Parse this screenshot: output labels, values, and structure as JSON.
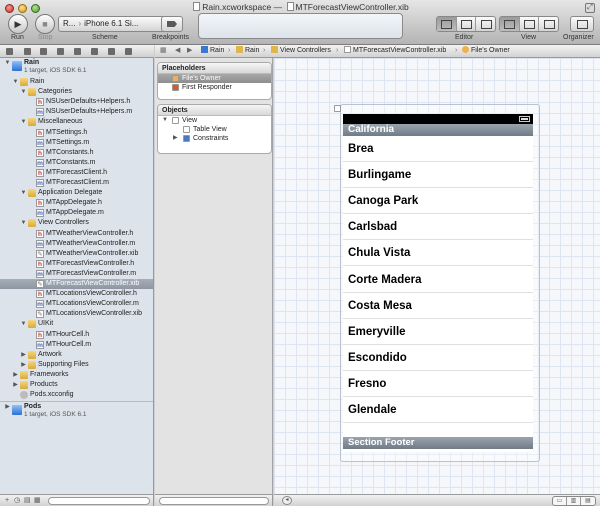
{
  "window": {
    "workspace": "Rain.xcworkspace",
    "separator": "—",
    "document": "MTForecastViewController.xib"
  },
  "toolbar": {
    "run_label": "Run",
    "stop_label": "Stop",
    "scheme_label": "Scheme",
    "breakpoints_label": "Breakpoints",
    "editor_label": "Editor",
    "view_label": "View",
    "organizer_label": "Organizer",
    "scheme_target": "R...",
    "scheme_separator": "›",
    "scheme_device": "iPhone 6.1 Si..."
  },
  "navigator": {
    "items": [
      {
        "label": "Rain",
        "sub": "1 target, iOS SDK 6.1",
        "icon": "project-icon",
        "indent": 0,
        "disclosure": "▼",
        "type": "project"
      },
      {
        "label": "Rain",
        "icon": "folder-icon",
        "indent": 1,
        "disclosure": "▼"
      },
      {
        "label": "Categories",
        "icon": "folder-icon",
        "indent": 2,
        "disclosure": "▼"
      },
      {
        "label": "NSUserDefaults+Helpers.h",
        "icon": "header-file-icon",
        "indent": 3
      },
      {
        "label": "NSUserDefaults+Helpers.m",
        "icon": "implementation-file-icon",
        "indent": 3
      },
      {
        "label": "Miscellaneous",
        "icon": "folder-icon",
        "indent": 2,
        "disclosure": "▼"
      },
      {
        "label": "MTSettings.h",
        "icon": "header-file-icon",
        "indent": 3
      },
      {
        "label": "MTSettings.m",
        "icon": "implementation-file-icon",
        "indent": 3
      },
      {
        "label": "MTConstants.h",
        "icon": "header-file-icon",
        "indent": 3
      },
      {
        "label": "MTConstants.m",
        "icon": "implementation-file-icon",
        "indent": 3
      },
      {
        "label": "MTForecastClient.h",
        "icon": "header-file-icon",
        "indent": 3
      },
      {
        "label": "MTForecastClient.m",
        "icon": "implementation-file-icon",
        "indent": 3
      },
      {
        "label": "Application Delegate",
        "icon": "folder-icon",
        "indent": 2,
        "disclosure": "▼"
      },
      {
        "label": "MTAppDelegate.h",
        "icon": "header-file-icon",
        "indent": 3
      },
      {
        "label": "MTAppDelegate.m",
        "icon": "implementation-file-icon",
        "indent": 3
      },
      {
        "label": "View Controllers",
        "icon": "folder-icon",
        "indent": 2,
        "disclosure": "▼"
      },
      {
        "label": "MTWeatherViewController.h",
        "icon": "header-file-icon",
        "indent": 3
      },
      {
        "label": "MTWeatherViewController.m",
        "icon": "implementation-file-icon",
        "indent": 3
      },
      {
        "label": "MTWeatherViewController.xib",
        "icon": "xib-file-icon",
        "indent": 3
      },
      {
        "label": "MTForecastViewController.h",
        "icon": "header-file-icon",
        "indent": 3
      },
      {
        "label": "MTForecastViewController.m",
        "icon": "implementation-file-icon",
        "indent": 3
      },
      {
        "label": "MTForecastViewController.xib",
        "icon": "xib-file-icon",
        "indent": 3,
        "selected": true
      },
      {
        "label": "MTLocationsViewController.h",
        "icon": "header-file-icon",
        "indent": 3
      },
      {
        "label": "MTLocationsViewController.m",
        "icon": "implementation-file-icon",
        "indent": 3
      },
      {
        "label": "MTLocationsViewController.xib",
        "icon": "xib-file-icon",
        "indent": 3
      },
      {
        "label": "UIKit",
        "icon": "folder-icon",
        "indent": 2,
        "disclosure": "▼"
      },
      {
        "label": "MTHourCell.h",
        "icon": "header-file-icon",
        "indent": 3
      },
      {
        "label": "MTHourCell.m",
        "icon": "implementation-file-icon",
        "indent": 3
      },
      {
        "label": "Artwork",
        "icon": "folder-icon",
        "indent": 2,
        "disclosure": "▶"
      },
      {
        "label": "Supporting Files",
        "icon": "folder-icon",
        "indent": 2,
        "disclosure": "▶"
      },
      {
        "label": "Frameworks",
        "icon": "folder-icon",
        "indent": 1,
        "disclosure": "▶"
      },
      {
        "label": "Products",
        "icon": "folder-icon",
        "indent": 1,
        "disclosure": "▶"
      },
      {
        "label": "Pods.xcconfig",
        "icon": "config-file-icon",
        "indent": 1
      },
      {
        "label": "Pods",
        "sub": "1 target, iOS SDK 6.1",
        "icon": "project-icon",
        "indent": 0,
        "disclosure": "▶",
        "type": "project"
      }
    ]
  },
  "jumpbar": {
    "items": [
      "Rain",
      "Rain",
      "View Controllers",
      "MTForecastViewController.xib",
      "File's Owner"
    ]
  },
  "outline": {
    "placeholders_title": "Placeholders",
    "objects_title": "Objects",
    "placeholders": [
      {
        "label": "File's Owner",
        "selected": true,
        "color": "#f0b050"
      },
      {
        "label": "First Responder",
        "color": "#d85a2a"
      }
    ],
    "objects": [
      {
        "label": "View",
        "disclosure": "▼",
        "indent": 0,
        "color": "#ffffff"
      },
      {
        "label": "Table View",
        "indent": 1,
        "color": "#ffffff"
      },
      {
        "label": "Constraints",
        "disclosure": "▶",
        "indent": 1,
        "color": "#4a78c8"
      }
    ]
  },
  "table": {
    "section_header": "California",
    "rows": [
      "Brea",
      "Burlingame",
      "Canoga Park",
      "Carlsbad",
      "Chula Vista",
      "Corte Madera",
      "Costa Mesa",
      "Emeryville",
      "Escondido",
      "Fresno",
      "Glendale"
    ],
    "section_footer": "Section Footer"
  }
}
